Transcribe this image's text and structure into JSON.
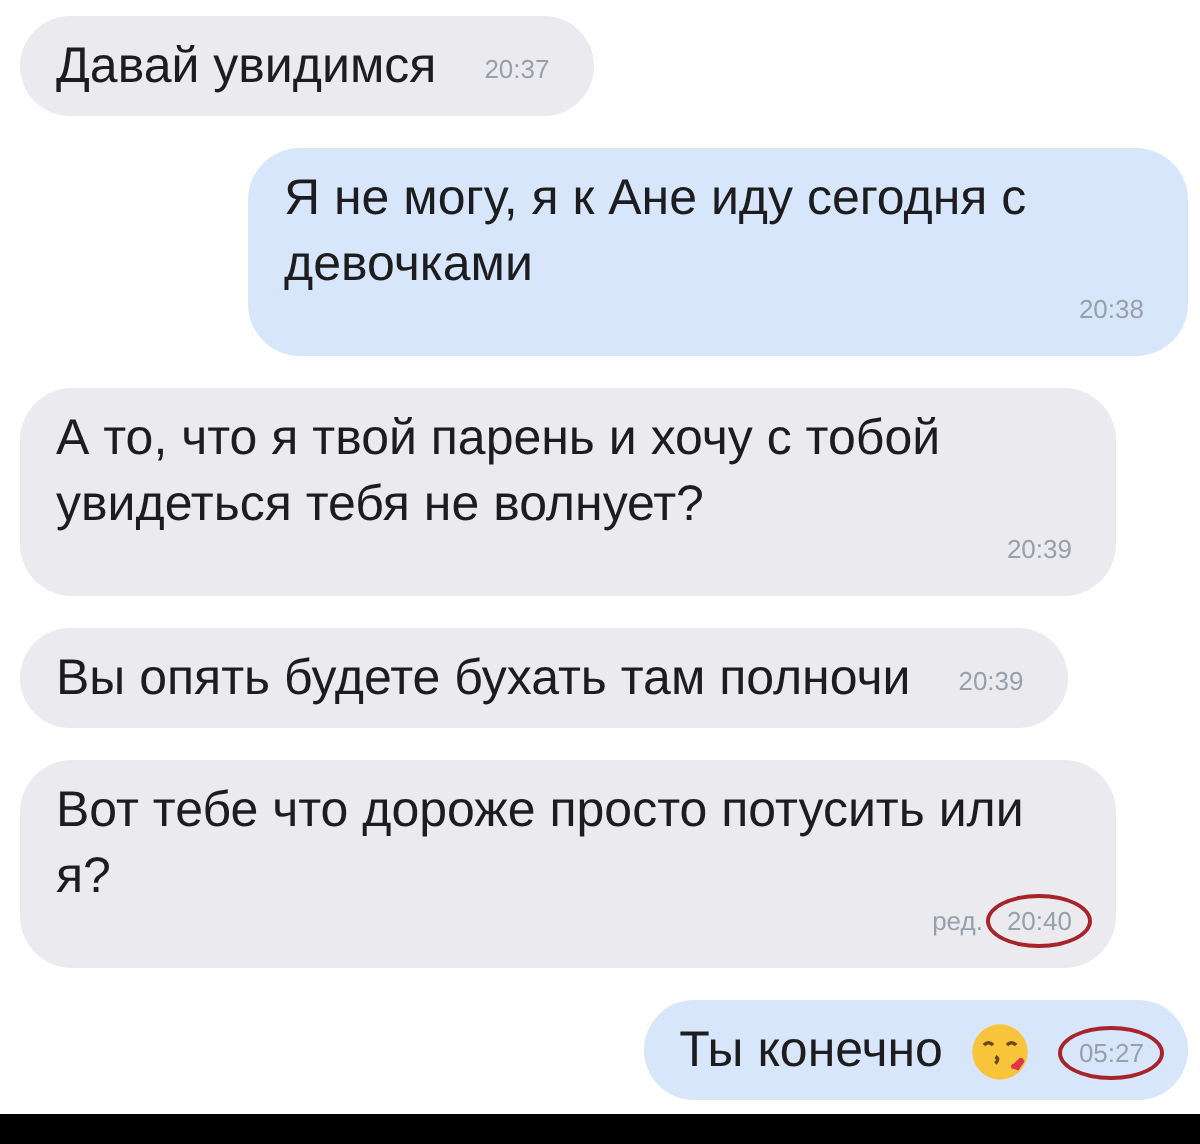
{
  "messages": [
    {
      "outgoing": false,
      "text": "Давай увидимся",
      "time": "20:37",
      "circled": false
    },
    {
      "outgoing": true,
      "text": "Я не могу, я к Ане иду сегодня с девочками",
      "time": "20:38",
      "circled": false
    },
    {
      "outgoing": false,
      "text": "А то, что я твой парень и хочу с тобой увидеться тебя не волнует?",
      "time": "20:39",
      "circled": false
    },
    {
      "outgoing": false,
      "text": "Вы опять будете бухать там полночи",
      "time": "20:39",
      "circled": false
    },
    {
      "outgoing": false,
      "text": "Вот тебе что дороже просто потусить или я?",
      "edited": "ред.",
      "time": "20:40",
      "circled": true
    },
    {
      "outgoing": true,
      "text": "Ты конечно",
      "emoji": true,
      "time": "05:27",
      "circled": true
    }
  ]
}
